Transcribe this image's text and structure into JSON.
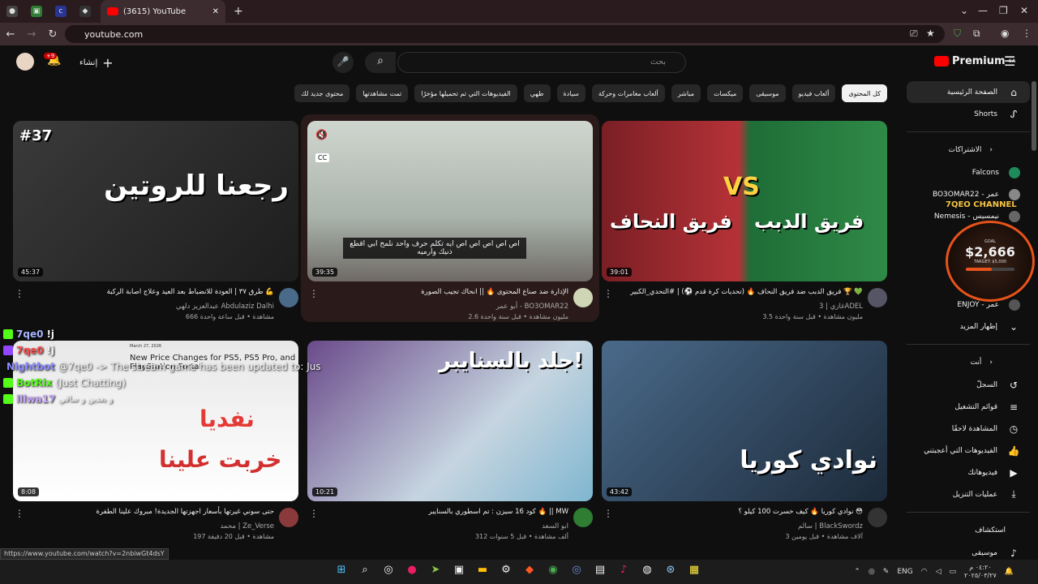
{
  "browser": {
    "tab_title": "(3615) YouTube",
    "url": "youtube.com",
    "status_url": "https://www.youtube.com/watch?v=2nbiwGt4dsY",
    "pinned_tabs": [
      "tab1",
      "tab2",
      "tab3",
      "tab4"
    ]
  },
  "header": {
    "logo_text": "Premium",
    "region": "SA",
    "search_placeholder": "بحث",
    "create_label": "إنشاء",
    "notif_count": "+9"
  },
  "chips": [
    {
      "label": "كل المحتوى",
      "active": true
    },
    {
      "label": "ألعاب فيديو",
      "active": false
    },
    {
      "label": "موسيقى",
      "active": false
    },
    {
      "label": "ميكسات",
      "active": false
    },
    {
      "label": "مباشر",
      "active": false
    },
    {
      "label": "ألعاب مغامرات وحركة",
      "active": false
    },
    {
      "label": "سيادة",
      "active": false
    },
    {
      "label": "طهي",
      "active": false
    },
    {
      "label": "الفيديوهات التي تم تحميلها مؤخرًا",
      "active": false
    },
    {
      "label": "تمت مشاهدتها",
      "active": false
    },
    {
      "label": "محتوى جديد لك",
      "active": false
    }
  ],
  "sidebar": {
    "home": "الصفحة الرئيسية",
    "shorts": "Shorts",
    "subs_header": "الاشتراكات",
    "subs": [
      "Falcons",
      "BO3OMAR22 - عمر",
      "Nemesis - نيمسيس",
      "ENJOY - عمر"
    ],
    "show_more": "إظهار المزيد",
    "you_header": "أنت",
    "you_items": [
      "السجلّ",
      "قوائم التشغيل",
      "المشاهدة لاحقًا",
      "الفيديوهات التي أعجبتني",
      "فيديوهاتك",
      "عمليات التنزيل"
    ],
    "explore_header": "استكشاف",
    "explore_items": [
      "موسيقى"
    ]
  },
  "videos": [
    {
      "title": "فريق الدبب ضد فريق النحاف 🔥 (تحديات كرة قدم ⚽) | #التحدي_الكبير 🏆 💚",
      "channel": "غازي | 3ADEL",
      "stats": "3.5 مليون مشاهدة • قبل سنة واحدة",
      "duration": "39:01",
      "thumb_text1": "فريق الدبب",
      "thumb_text2": "فريق النحاف",
      "vs": "VS"
    },
    {
      "title": "الإدارة ضد صناع المحتوى 🔥 || انحاك تجيب الصورة",
      "channel": "أبو عمر - BO3OMAR22",
      "stats": "2.6 مليون مشاهدة • قبل سنة واحدة",
      "duration": "39:35",
      "subtitle": "اص اص اص اص اص ايه تكلم حرف واحد نلمح ابي اقطع ذنيك وارميه",
      "cc": "CC"
    },
    {
      "title": "طرق ٣٧ | العودة للانضباط بعد العيد وعلاج اصابة الركبة 💪",
      "channel": "عبدالعزيز دلهي Abdulaziz Dalhi",
      "stats": "666 مشاهدة • قبل ساعة واحدة",
      "duration": "45:37",
      "episode": "#37",
      "thumb_text": "رجعنا للروتين"
    },
    {
      "title": "نوادي كوريا 🔥 كيف خسرت 100 كيلو ؟ 😳",
      "channel": "سالم | BlackSwordz",
      "stats": "3 آلاف مشاهدة • قبل يومين",
      "duration": "43:42",
      "thumb_text": "نوادي كوريا"
    },
    {
      "title": "كود 16 سيزن : تم اسطوري بالسنايبر 🔥 || MW",
      "channel": "ابو السعد",
      "stats": "312 ألف مشاهدة • قبل 5 سنوات",
      "duration": "10:21",
      "thumb_text": "جلد بالسنايبر!"
    },
    {
      "title": "حتى سوني غيرتها بأسعار اجهزتها الجديدة! مبروك علينا الطفرة",
      "channel": "محمد | Ze_Verse",
      "stats": "197 مشاهدة • قبل 20 دقيقة",
      "duration": "8:08",
      "thumb_text1": "نفديا",
      "thumb_text2": "خربت علينا",
      "news_title": "New Price Changes for PS5, PS5 Pro, and PlayStation Portal",
      "news_date": "March 27, 2026"
    }
  ],
  "chat": [
    {
      "user": "7qe0",
      "msg": "!j",
      "color": "#a7b4ff"
    },
    {
      "user": "7qe0",
      "msg": "!j",
      "color": "#a7b4ff"
    },
    {
      "user": "Nightbot",
      "msg": "@7qe0 -> The stream game has been updated to: Jus",
      "color": "#8b8bff"
    },
    {
      "user": "BotRix",
      "msg": "(Just Chatting)",
      "color": "#53fc18"
    },
    {
      "user": "lllwa17",
      "msg": "و بعدين و ساقي",
      "color": "#c9a6ff"
    }
  ],
  "overlay": {
    "channel": "7QEO CHANNEL",
    "goal_label": "GOAL",
    "amount": "$2,666",
    "target": "TARGET: $5,000",
    "progress": 0.53
  },
  "taskbar": {
    "lang": "ENG",
    "time": "٠٤:٢٠ م",
    "date": "٢٠٢٥/٠٣/٢٧"
  },
  "colors": {
    "bg": "#0f0f0f",
    "accent": "#ff0000",
    "chip_active": "#f1f1f1"
  }
}
